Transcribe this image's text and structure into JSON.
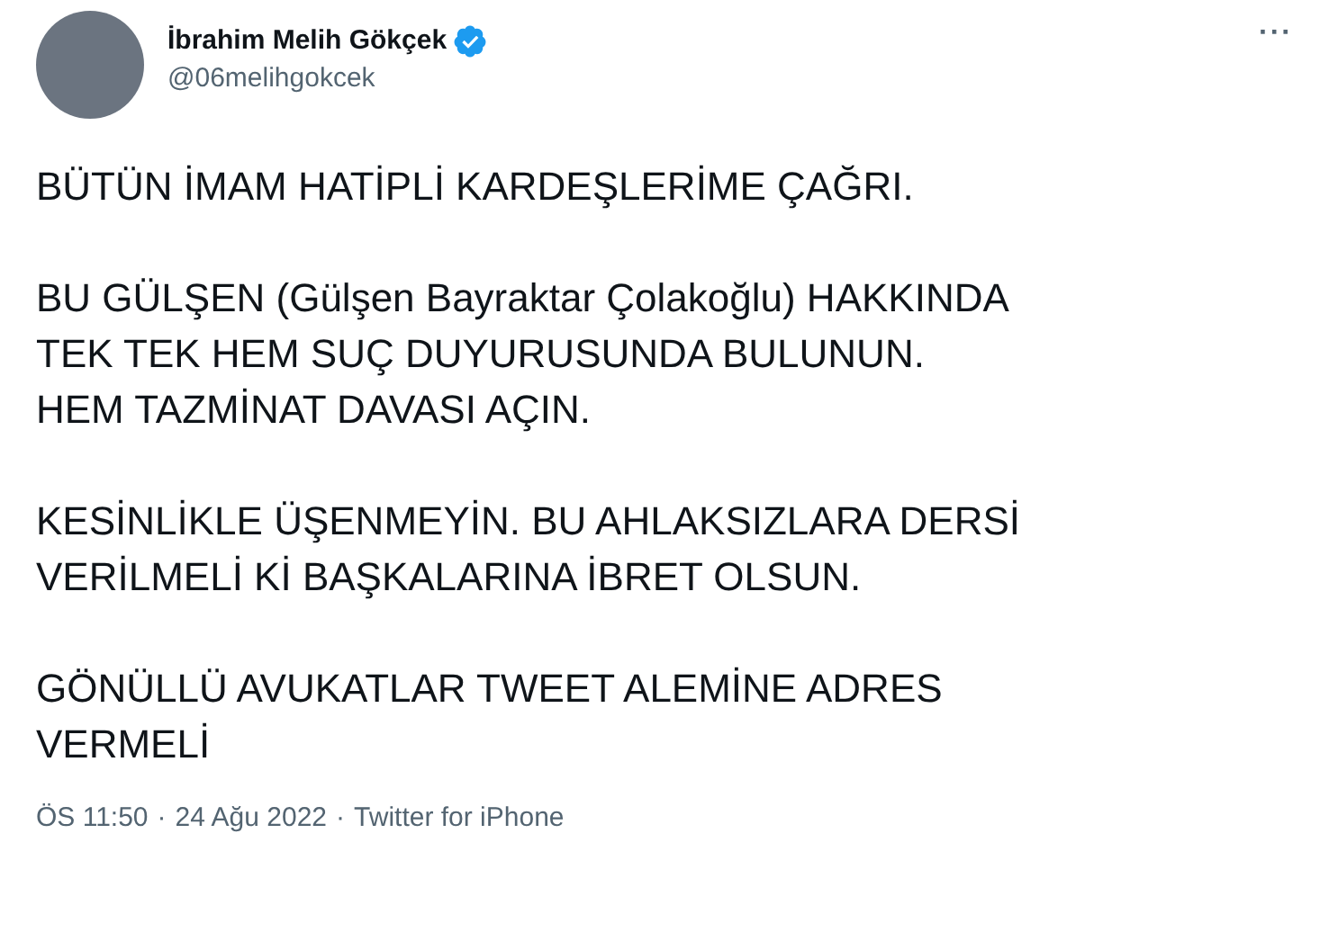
{
  "author": {
    "name": "İbrahim Melih Gökçek",
    "handle": "@06melihgokcek",
    "verified": true
  },
  "more_button": "···",
  "paragraphs": [
    "BÜTÜN İMAM HATİPLİ KARDEŞLERİME ÇAĞRI.",
    "BU GÜLŞEN (Gülşen Bayraktar Çolakoğlu) HAKKINDA\nTEK TEK HEM SUÇ DUYURUSUNDA BULUNUN.\nHEM TAZMİNAT DAVASI AÇIN.",
    "KESİNLİKLE ÜŞENMEYİN. BU AHLAKSIZLARA DERSİ\nVERİLMELİ Kİ BAŞKALARINA İBRET OLSUN.",
    "GÖNÜLLÜ AVUKATLAR TWEET ALEMİNE ADRES\nVERMELİ"
  ],
  "footer": {
    "time": "ÖS 11:50",
    "separator": "·",
    "date": "24 Ağu 2022",
    "source": "Twitter for iPhone"
  }
}
